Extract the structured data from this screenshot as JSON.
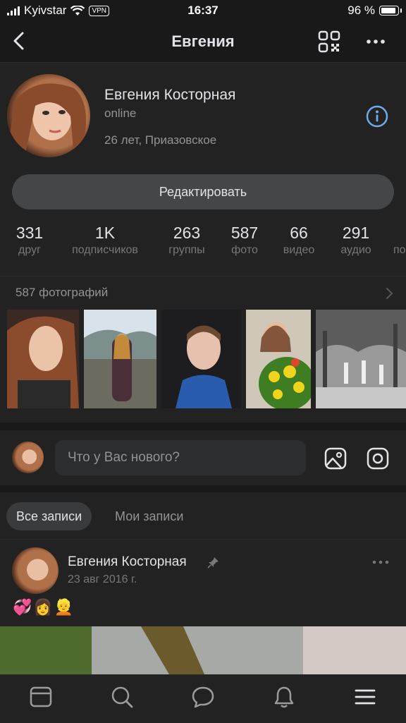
{
  "status_bar": {
    "carrier": "Kyivstar",
    "vpn": "VPN",
    "time": "16:37",
    "battery": "96 %"
  },
  "nav": {
    "title": "Евгения",
    "icons": [
      "back-icon",
      "qr-code-icon",
      "more-icon"
    ]
  },
  "profile": {
    "name": "Евгения Косторная",
    "status": "online",
    "info": "26 лет, Приазовское",
    "edit_button": "Редактировать",
    "counters": [
      {
        "value": "331",
        "label": "друг"
      },
      {
        "value": "1K",
        "label": "подписчиков"
      },
      {
        "value": "263",
        "label": "группы"
      },
      {
        "value": "587",
        "label": "фото"
      },
      {
        "value": "66",
        "label": "видео"
      },
      {
        "value": "291",
        "label": "аудио"
      },
      {
        "value": "",
        "label": "по"
      }
    ],
    "photos_header": "587 фотографий"
  },
  "composer": {
    "placeholder": "Что у Вас нового?"
  },
  "wall": {
    "tabs": [
      "Все записи",
      "Мои записи"
    ],
    "active_tab": "Все записи"
  },
  "post": {
    "author": "Евгения Косторная",
    "date": "23 авг 2016 г.",
    "text": "💞👩👱"
  },
  "tab_bar": {
    "icons": [
      "news-icon",
      "search-icon",
      "messages-icon",
      "notifications-icon",
      "menu-icon"
    ]
  },
  "colors": {
    "background": "#19191a",
    "surface": "#222222",
    "accent": "#71aaeb",
    "text_primary": "#e1e3e6",
    "text_secondary": "#939393"
  }
}
